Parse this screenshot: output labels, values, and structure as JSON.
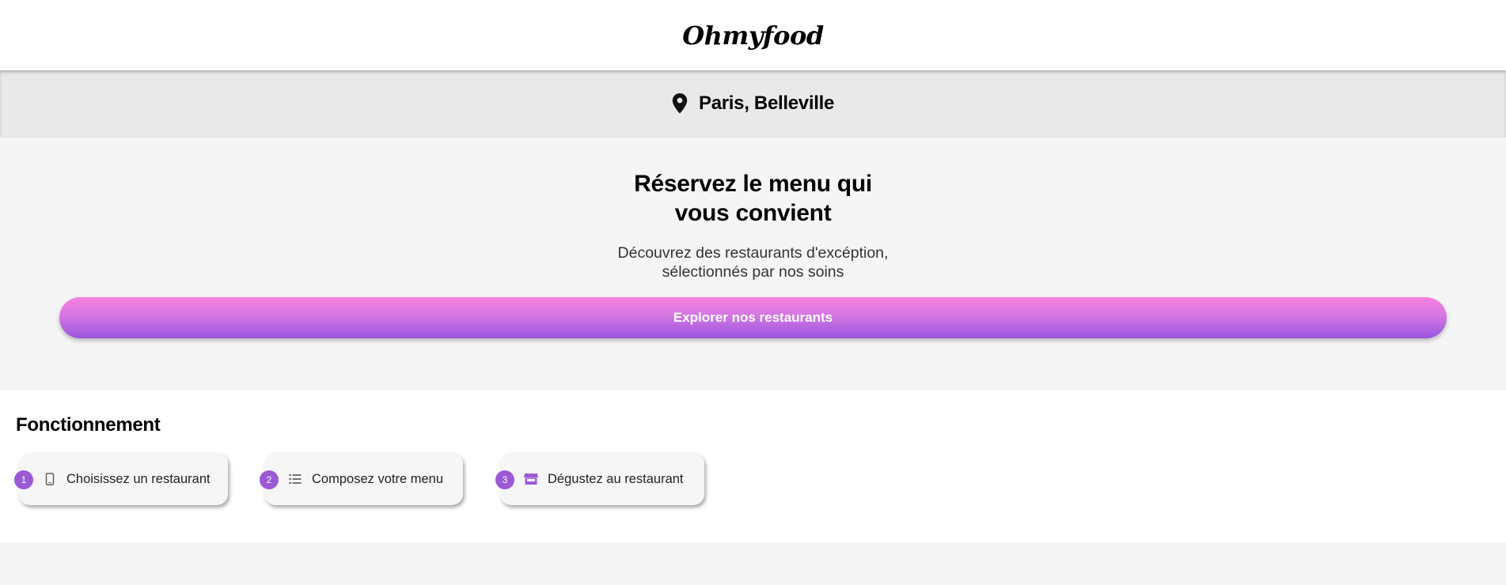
{
  "header": {
    "logo": "Ohmyfood"
  },
  "location": {
    "icon": "map-pin-icon",
    "text": "Paris, Belleville"
  },
  "hero": {
    "title_line1": "Réservez le menu qui",
    "title_line2": "vous convient",
    "subtitle_line1": "Découvrez des restaurants d'excéption,",
    "subtitle_line2": "sélectionnés par nos soins",
    "cta_label": "Explorer nos restaurants"
  },
  "how_it_works": {
    "title": "Fonctionnement",
    "steps": [
      {
        "number": "1",
        "icon": "mobile-phone-icon",
        "label": "Choisissez un restaurant"
      },
      {
        "number": "2",
        "icon": "list-icon",
        "label": "Composez votre menu"
      },
      {
        "number": "3",
        "icon": "store-icon",
        "label": "Dégustez au restaurant"
      }
    ]
  },
  "colors": {
    "accent_purple": "#9b59d6",
    "gradient_top": "#f87fdb",
    "gradient_bottom": "#9a55dd"
  }
}
